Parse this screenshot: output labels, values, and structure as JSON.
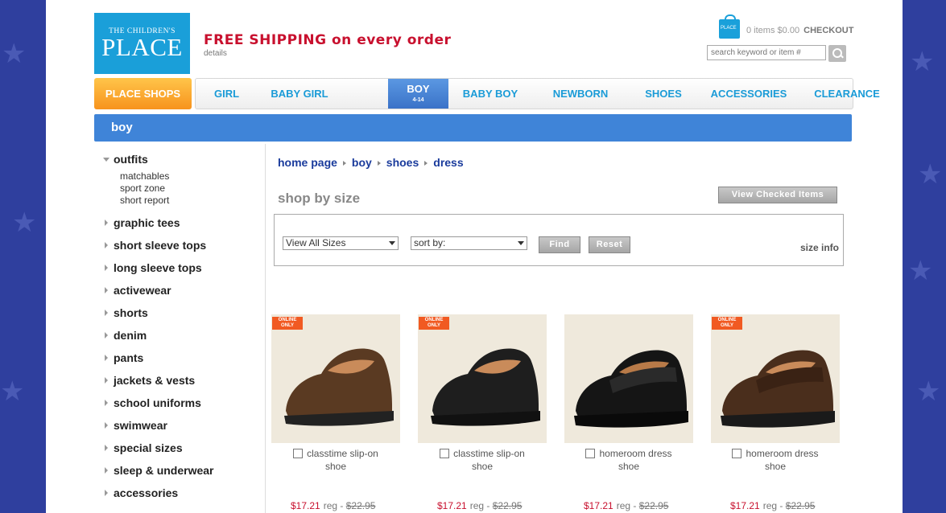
{
  "header": {
    "logo_line1": "THE CHILDREN'S",
    "logo_line2": "PLACE",
    "promo_title": "FREE SHIPPING on every order",
    "promo_details": "details",
    "cart_items": "0 items",
    "cart_total": "$0.00",
    "checkout": "CHECKOUT",
    "search_placeholder": "search keyword or item #"
  },
  "nav": {
    "place_shops": "PLACE SHOPS",
    "items": [
      {
        "label": "GIRL"
      },
      {
        "label": "BABY GIRL"
      },
      {
        "label": "BOY",
        "sub": "4-14"
      },
      {
        "label": "BABY BOY"
      },
      {
        "label": "NEWBORN"
      },
      {
        "label": "SHOES"
      },
      {
        "label": "ACCESSORIES"
      },
      {
        "label": "CLEARANCE"
      }
    ]
  },
  "category_title": "boy",
  "sidebar": {
    "outfits": "outfits",
    "outfit_subs": [
      "matchables",
      "sport zone",
      "short report"
    ],
    "categories": [
      "graphic tees",
      "short sleeve tops",
      "long sleeve tops",
      "activewear",
      "shorts",
      "denim",
      "pants",
      "jackets & vests",
      "school uniforms",
      "swimwear",
      "special sizes",
      "sleep & underwear",
      "accessories"
    ]
  },
  "breadcrumb": [
    "home page",
    "boy",
    "shoes",
    "dress"
  ],
  "shop_by_size": "shop by size",
  "view_checked": "View Checked Items",
  "filters": {
    "size_select": "View All Sizes",
    "sort_select": "sort by:",
    "find": "Find",
    "reset": "Reset",
    "size_info": "size info"
  },
  "products": [
    {
      "badge": "ONLINE ONLY",
      "name1": "classtime slip-on",
      "name2": "shoe",
      "sale": "$17.21",
      "reg": "reg -",
      "was": "$22.95",
      "color": "#5a3a22"
    },
    {
      "badge": "ONLINE ONLY",
      "name1": "classtime slip-on",
      "name2": "shoe",
      "sale": "$17.21",
      "reg": "reg -",
      "was": "$22.95",
      "color": "#1e1e1e"
    },
    {
      "badge": "",
      "name1": "homeroom dress",
      "name2": "shoe",
      "sale": "$17.21",
      "reg": "reg -",
      "was": "$22.95",
      "color": "#151515"
    },
    {
      "badge": "ONLINE ONLY",
      "name1": "homeroom dress",
      "name2": "shoe",
      "sale": "$17.21",
      "reg": "reg -",
      "was": "$22.95",
      "color": "#4a2e1c"
    }
  ]
}
